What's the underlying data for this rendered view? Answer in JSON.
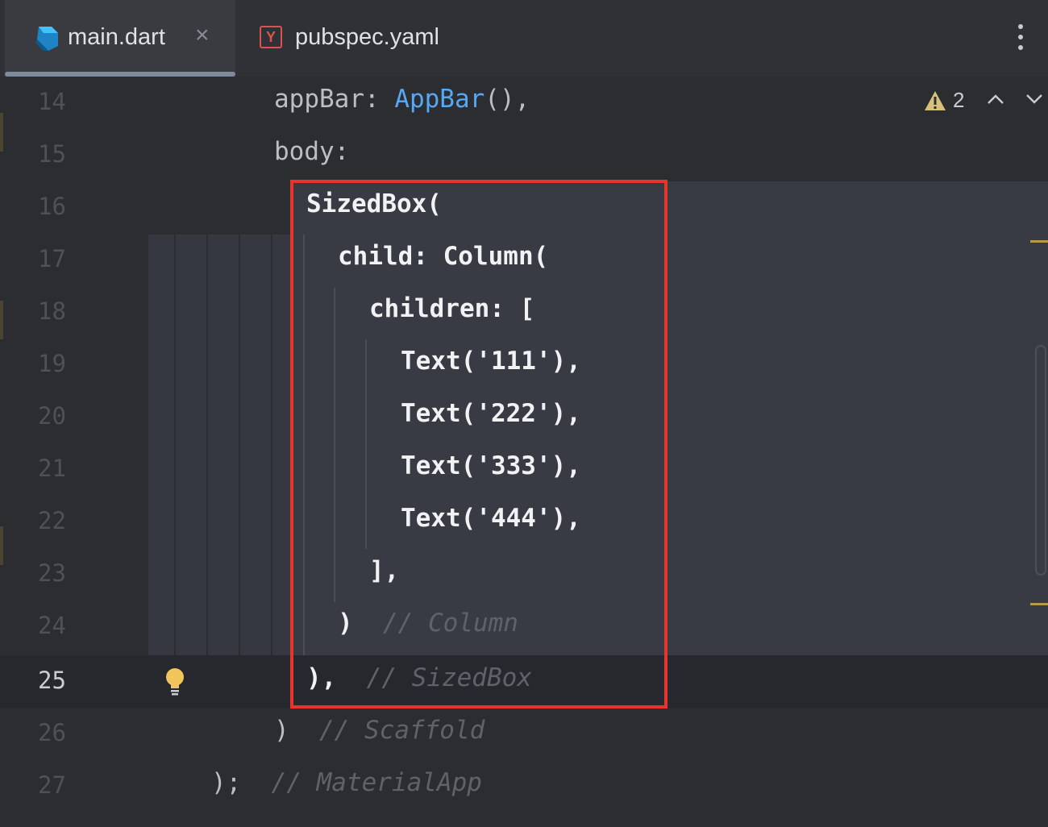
{
  "tabs": [
    {
      "label": "main.dart",
      "icon": "dart-icon",
      "active": true,
      "close": "×"
    },
    {
      "label": "pubspec.yaml",
      "icon": "yaml-icon",
      "icon_letter": "Y",
      "active": false
    }
  ],
  "editor": {
    "warnings_count": "2",
    "lines": [
      {
        "n": "14",
        "segments": [
          {
            "t": "appBar: "
          },
          {
            "t": "AppBar",
            "cls": "cls"
          },
          {
            "t": "(),"
          }
        ]
      },
      {
        "n": "15",
        "segments": [
          {
            "t": "body:"
          }
        ]
      },
      {
        "n": "16",
        "segments": [
          {
            "t": "SizedBox("
          }
        ]
      },
      {
        "n": "17",
        "segments": [
          {
            "t": "child: Column("
          }
        ]
      },
      {
        "n": "18",
        "segments": [
          {
            "t": "children: ["
          }
        ]
      },
      {
        "n": "19",
        "segments": [
          {
            "t": "Text('111'),"
          }
        ]
      },
      {
        "n": "20",
        "segments": [
          {
            "t": "Text('222'),"
          }
        ]
      },
      {
        "n": "21",
        "segments": [
          {
            "t": "Text('333'),"
          }
        ]
      },
      {
        "n": "22",
        "segments": [
          {
            "t": "Text('444'),"
          }
        ]
      },
      {
        "n": "23",
        "segments": [
          {
            "t": "],"
          }
        ]
      },
      {
        "n": "24",
        "segments": [
          {
            "t": ")  "
          },
          {
            "t": "// Column",
            "cls": "comment"
          }
        ]
      },
      {
        "n": "25",
        "segments": [
          {
            "t": "),  "
          },
          {
            "t": "// SizedBox",
            "cls": "comment"
          }
        ]
      },
      {
        "n": "26",
        "segments": [
          {
            "t": ")  "
          },
          {
            "t": "// Scaffold",
            "cls": "comment"
          }
        ]
      },
      {
        "n": "27",
        "segments": [
          {
            "t": ");  "
          },
          {
            "t": "// MaterialApp",
            "cls": "comment"
          }
        ]
      }
    ]
  },
  "colors": {
    "highlight_border": "#e8352b",
    "class_name": "#56a8f5",
    "comment": "#5f6269",
    "background": "#2b2d30"
  }
}
